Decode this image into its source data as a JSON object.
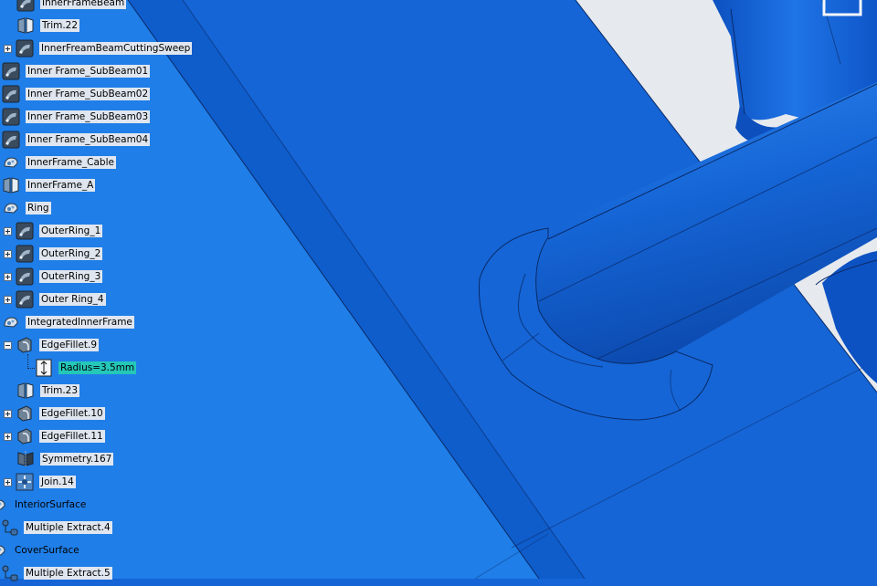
{
  "tree": {
    "items": [
      {
        "label": "InnerFrameBeam",
        "icon": "sweep-surface-icon",
        "expander": "none"
      },
      {
        "label": "Trim.22",
        "icon": "trim-icon",
        "expander": "none"
      },
      {
        "label": "InnerFreamBeamCuttingSweep",
        "icon": "sweep-surface-icon",
        "expander": "plus"
      },
      {
        "label": "Inner Frame_SubBeam01",
        "icon": "sweep-surface-icon",
        "expander": "none"
      },
      {
        "label": "Inner Frame_SubBeam02",
        "icon": "sweep-surface-icon",
        "expander": "none"
      },
      {
        "label": "Inner Frame_SubBeam03",
        "icon": "sweep-surface-icon",
        "expander": "none"
      },
      {
        "label": "Inner Frame_SubBeam04",
        "icon": "sweep-surface-icon",
        "expander": "none"
      },
      {
        "label": "InnerFrame_Cable",
        "icon": "geometrical-set-icon",
        "expander": "none"
      },
      {
        "label": "InnerFrame_A",
        "icon": "trim-icon",
        "expander": "none"
      },
      {
        "label": "Ring",
        "icon": "geometrical-set-icon",
        "expander": "none"
      },
      {
        "label": "OuterRing_1",
        "icon": "sweep-surface-icon",
        "expander": "plus"
      },
      {
        "label": "OuterRing_2",
        "icon": "sweep-surface-icon",
        "expander": "plus"
      },
      {
        "label": "OuterRing_3",
        "icon": "sweep-surface-icon",
        "expander": "plus"
      },
      {
        "label": "Outer Ring_4",
        "icon": "sweep-surface-icon",
        "expander": "plus"
      },
      {
        "label": "IntegratedInnerFrame",
        "icon": "geometrical-set-icon",
        "expander": "none"
      },
      {
        "label": "EdgeFillet.9",
        "icon": "edge-fillet-icon",
        "expander": "minus"
      },
      {
        "label": "Radius=3.5mm",
        "icon": "radius-parameter-icon",
        "expander": "none",
        "selected": true
      },
      {
        "label": "Trim.23",
        "icon": "trim-icon",
        "expander": "none"
      },
      {
        "label": "EdgeFillet.10",
        "icon": "edge-fillet-icon",
        "expander": "plus"
      },
      {
        "label": "EdgeFillet.11",
        "icon": "edge-fillet-icon",
        "expander": "plus"
      },
      {
        "label": "Symmetry.167",
        "icon": "symmetry-icon",
        "expander": "none"
      },
      {
        "label": "Join.14",
        "icon": "join-icon",
        "expander": "plus"
      },
      {
        "label": "InteriorSurface",
        "icon": "geometrical-set-icon",
        "expander": "none"
      },
      {
        "label": "Multiple Extract.4",
        "icon": "multiple-extract-icon",
        "expander": "none"
      },
      {
        "label": "CoverSurface",
        "icon": "geometrical-set-icon",
        "expander": "none"
      },
      {
        "label": "Multiple Extract.5",
        "icon": "multiple-extract-icon",
        "expander": "none"
      }
    ]
  },
  "colors": {
    "viewport_blue": "#1565d6",
    "panel_blue": "#1e7de8",
    "selection": "#25c7b8",
    "label_bg": "#dfe6ef",
    "background_grey": "#e6e9ee"
  }
}
